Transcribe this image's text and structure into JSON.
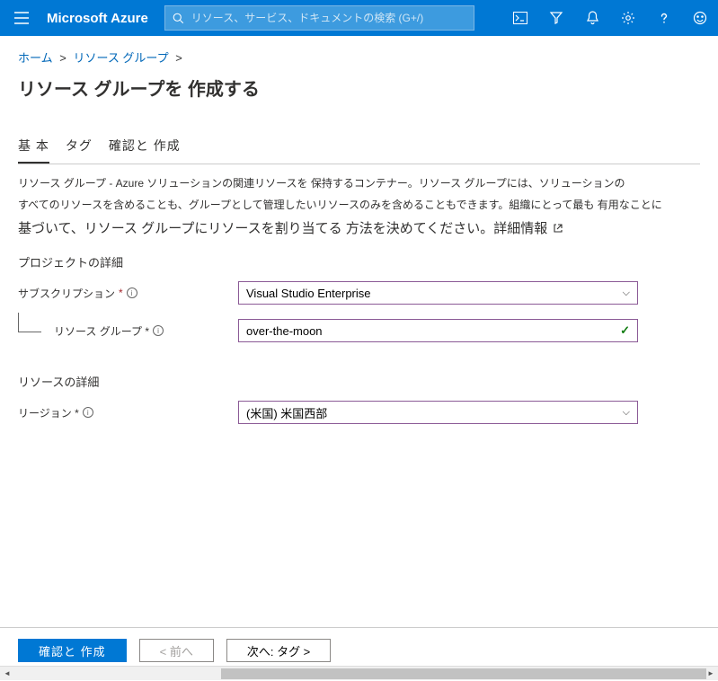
{
  "header": {
    "brand": "Microsoft Azure",
    "search_placeholder": "リソース、サービス、ドキュメントの検索 (G+/)"
  },
  "breadcrumb": {
    "home": "ホーム",
    "group": "リソース グループ"
  },
  "page_title": "リソース グループを 作成する",
  "tabs": {
    "basic": "基 本",
    "tags": "タグ",
    "review": "確認と 作成"
  },
  "desc": {
    "line1": "リソース グループ -  Azure ソリューションの関連リソースを 保持するコンテナー。リソース グループには、ソリューションの",
    "line2": "すべてのリソースを含めることも、グループとして管理したいリソースのみを含めることもできます。組織にとって最も 有用なことに",
    "line3": "基づいて、リソース グループにリソースを割り当てる 方法を決めてください。詳細情報"
  },
  "sections": {
    "project": "プロジェクトの詳細",
    "resource": "リソースの詳細"
  },
  "fields": {
    "subscription_label": "サブスクリプション",
    "subscription_value": "Visual Studio Enterprise",
    "resource_group_label": "リソース グループ *",
    "resource_group_value": "over-the-moon",
    "region_label": "リージョン *",
    "region_value": "(米国) 米国西部"
  },
  "footer": {
    "review": "確認と 作成",
    "prev": "< 前へ",
    "next": "次へ:  タグ >"
  }
}
